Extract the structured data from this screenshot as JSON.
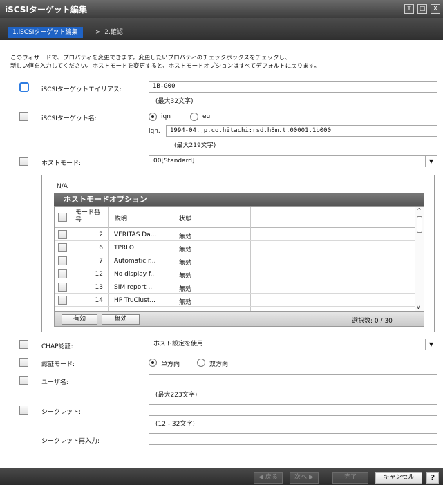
{
  "window": {
    "title": "iSCSIターゲット編集",
    "buttons": [
      "T",
      "□",
      "X"
    ]
  },
  "breadcrumb": {
    "active": "1.iSCSIターゲット編集",
    "sep": ">",
    "next": "2.確認"
  },
  "intro": {
    "line1": "このウィザードで、プロパティを変更できます。変更したいプロパティのチェックボックスをチェックし、",
    "line2": "新しい値を入力してください。ホストモードを変更すると、ホストモードオプションはすべてデフォルトに戻ります。"
  },
  "alias": {
    "label": "iSCSIターゲットエイリアス:",
    "value": "1B-G00",
    "hint": "(最大32文字)"
  },
  "target_name": {
    "label": "iSCSIターゲット名:",
    "opt_iqn": "iqn",
    "opt_eui": "eui",
    "prefix": "iqn.",
    "value": "1994-04.jp.co.hitachi:rsd.h8m.t.00001.1b000",
    "hint": "(最大219文字)"
  },
  "host_mode": {
    "label": "ホストモード:",
    "value": "00[Standard]",
    "na": "N/A"
  },
  "options_table": {
    "title": "ホストモードオプション",
    "headers": [
      "モード番号",
      "説明",
      "状態"
    ],
    "rows": [
      {
        "no": "2",
        "desc": "VERITAS Da...",
        "state": "無効"
      },
      {
        "no": "6",
        "desc": "TPRLO",
        "state": "無効"
      },
      {
        "no": "7",
        "desc": "Automatic r...",
        "state": "無効"
      },
      {
        "no": "12",
        "desc": "No display f...",
        "state": "無効"
      },
      {
        "no": "13",
        "desc": "SIM report ...",
        "state": "無効"
      },
      {
        "no": "14",
        "desc": "HP TruClust...",
        "state": "無効"
      }
    ],
    "enable_btn": "有効",
    "disable_btn": "無効",
    "selected_label": "選択数:",
    "selected": "0",
    "slash": "/",
    "total": "30"
  },
  "chap": {
    "label": "CHAP認証:",
    "value": "ホスト設定を使用"
  },
  "auth_mode": {
    "label": "認証モード:",
    "opt_one": "単方向",
    "opt_two": "双方向"
  },
  "user": {
    "label": "ユーザ名:",
    "hint": "(最大223文字)"
  },
  "secret": {
    "label": "シークレット:",
    "hint": "(12 - 32文字)",
    "confirm_label": "シークレット再入力:"
  },
  "footer": {
    "back": "◀ 戻る",
    "next": "次へ ▶",
    "finish": "完了",
    "cancel": "キャンセル",
    "help": "?"
  }
}
